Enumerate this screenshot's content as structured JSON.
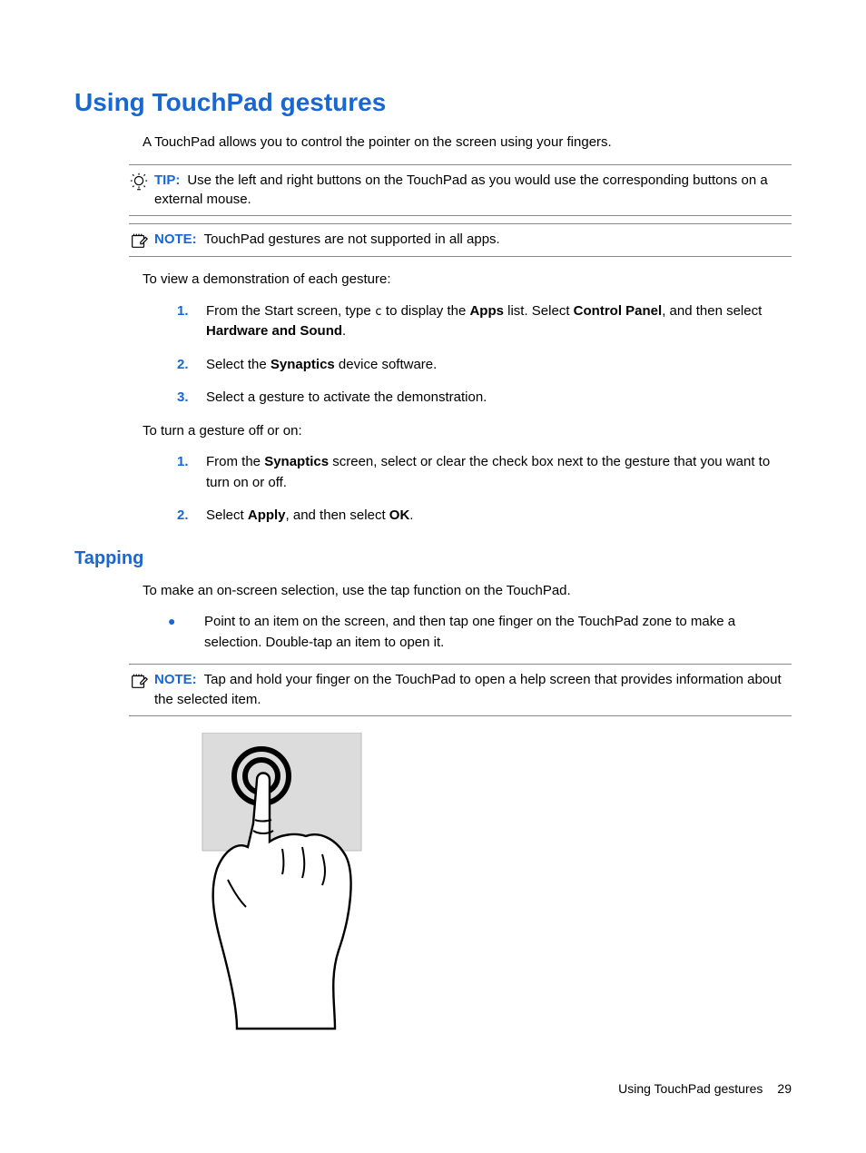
{
  "headings": {
    "main": "Using TouchPad gestures",
    "tapping": "Tapping"
  },
  "intro": {
    "touchpad_desc": "A TouchPad allows you to control the pointer on the screen using your fingers."
  },
  "callouts": {
    "tip": {
      "label": "TIP:",
      "text": "Use the left and right buttons on the TouchPad as you would use the corresponding buttons on a external mouse."
    },
    "note_apps": {
      "label": "NOTE:",
      "text": "TouchPad gestures are not supported in all apps."
    },
    "note_taphold": {
      "label": "NOTE:",
      "text": "Tap and hold your finger on the TouchPad to open a help screen that provides information about the selected item."
    }
  },
  "demo": {
    "intro": "To view a demonstration of each gesture:",
    "step1": {
      "pre": "From the Start screen, type ",
      "char": "c",
      "mid": " to display the ",
      "b1": "Apps",
      "mid2": " list. Select ",
      "b2": "Control Panel",
      "mid3": ", and then select ",
      "b3": "Hardware and Sound",
      "end": "."
    },
    "step2": {
      "pre": "Select the ",
      "b1": "Synaptics",
      "end": " device software."
    },
    "step3": "Select a gesture to activate the demonstration."
  },
  "toggle": {
    "intro": "To turn a gesture off or on:",
    "step1": {
      "pre": "From the ",
      "b1": "Synaptics",
      "end": " screen, select or clear the check box next to the gesture that you want to turn on or off."
    },
    "step2": {
      "pre": "Select ",
      "b1": "Apply",
      "mid": ", and then select ",
      "b2": "OK",
      "end": "."
    }
  },
  "tapping": {
    "desc": "To make an on-screen selection, use the tap function on the TouchPad.",
    "bullet1": "Point to an item on the screen, and then tap one finger on the TouchPad zone to make a selection. Double-tap an item to open it."
  },
  "nums": {
    "n1": "1.",
    "n2": "2.",
    "n3": "3."
  },
  "footer": {
    "running": "Using TouchPad gestures",
    "page": "29"
  }
}
